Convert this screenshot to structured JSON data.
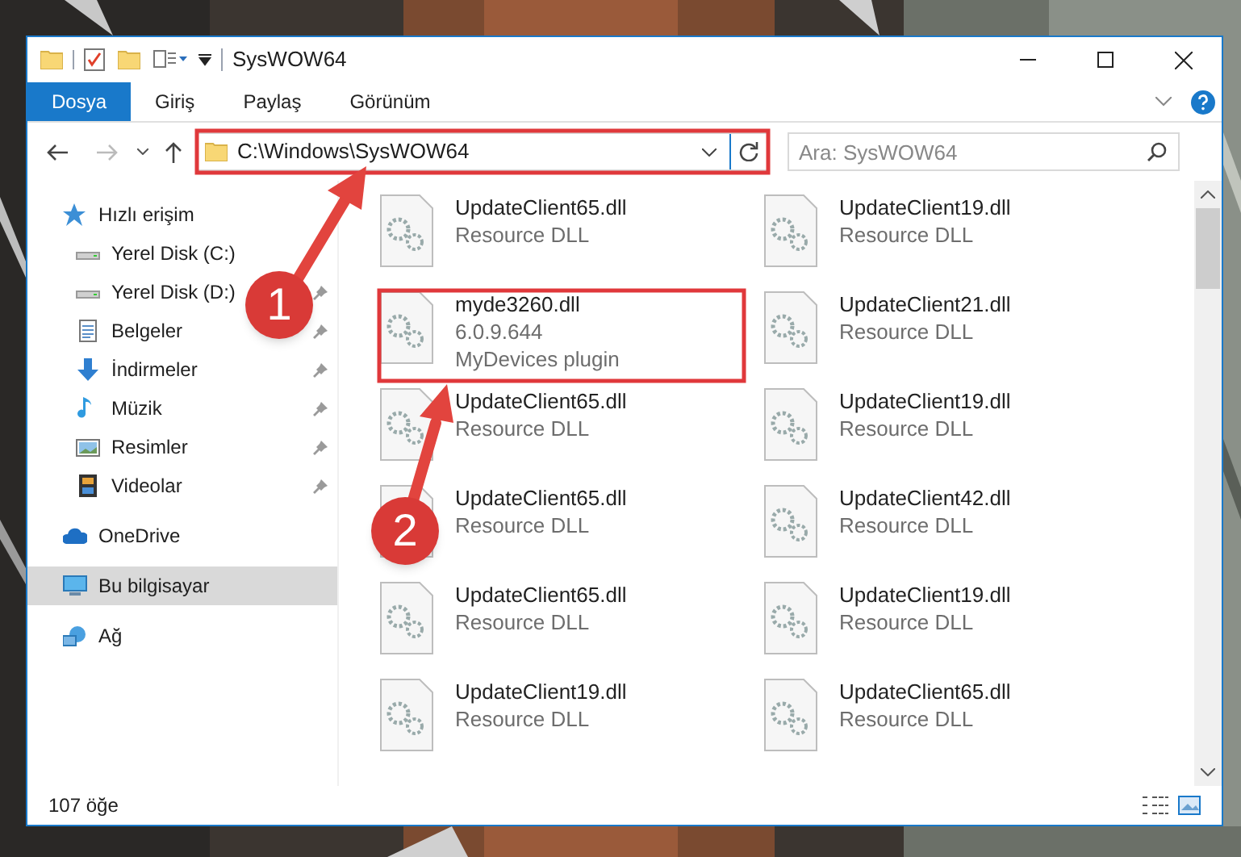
{
  "window": {
    "title": "SysWOW64"
  },
  "ribbon_tabs": [
    {
      "label": "Dosya",
      "kind": "file"
    },
    {
      "label": "Giriş",
      "kind": "tab"
    },
    {
      "label": "Paylaş",
      "kind": "tab"
    },
    {
      "label": "Görünüm",
      "kind": "tab"
    }
  ],
  "address_bar": {
    "value": "C:\\Windows\\SysWOW64"
  },
  "search": {
    "placeholder": "Ara: SysWOW64"
  },
  "navigation": [
    {
      "label": "Hızlı erişim",
      "kind": "star",
      "selected": false,
      "children": [
        {
          "label": "Yerel Disk (C:)",
          "kind": "drive",
          "pinned": false,
          "selected": false
        },
        {
          "label": "Yerel Disk (D:)",
          "kind": "drive",
          "pinned": true,
          "selected": false
        },
        {
          "label": "Belgeler",
          "kind": "document",
          "pinned": true,
          "selected": false
        },
        {
          "label": "İndirmeler",
          "kind": "download",
          "pinned": true,
          "selected": false
        },
        {
          "label": "Müzik",
          "kind": "music",
          "pinned": true,
          "selected": false
        },
        {
          "label": "Resimler",
          "kind": "pictures",
          "pinned": true,
          "selected": false
        },
        {
          "label": "Videolar",
          "kind": "video",
          "pinned": true,
          "selected": false
        }
      ]
    },
    {
      "label": "OneDrive",
      "kind": "cloud",
      "selected": false
    },
    {
      "label": "Bu bilgisayar",
      "kind": "computer",
      "selected": true
    },
    {
      "label": "Ağ",
      "kind": "network",
      "selected": false
    }
  ],
  "files": [
    {
      "name": "UpdateClient65.dll",
      "details": [
        "Resource DLL"
      ]
    },
    {
      "name": "UpdateClient19.dll",
      "details": [
        "Resource DLL"
      ]
    },
    {
      "name": "myde3260.dll",
      "details": [
        "6.0.9.644",
        "MyDevices plugin"
      ]
    },
    {
      "name": "UpdateClient21.dll",
      "details": [
        "Resource DLL"
      ]
    },
    {
      "name": "UpdateClient65.dll",
      "details": [
        "Resource DLL"
      ]
    },
    {
      "name": "UpdateClient19.dll",
      "details": [
        "Resource DLL"
      ]
    },
    {
      "name": "UpdateClient65.dll",
      "details": [
        "Resource DLL"
      ]
    },
    {
      "name": "UpdateClient42.dll",
      "details": [
        "Resource DLL"
      ]
    },
    {
      "name": "UpdateClient65.dll",
      "details": [
        "Resource DLL"
      ]
    },
    {
      "name": "UpdateClient19.dll",
      "details": [
        "Resource DLL"
      ]
    },
    {
      "name": "UpdateClient19.dll",
      "details": [
        "Resource DLL"
      ]
    },
    {
      "name": "UpdateClient65.dll",
      "details": [
        "Resource DLL"
      ]
    }
  ],
  "status_bar": {
    "item_count": "107 öğe"
  },
  "annotations": [
    {
      "label": "1"
    },
    {
      "label": "2"
    }
  ]
}
